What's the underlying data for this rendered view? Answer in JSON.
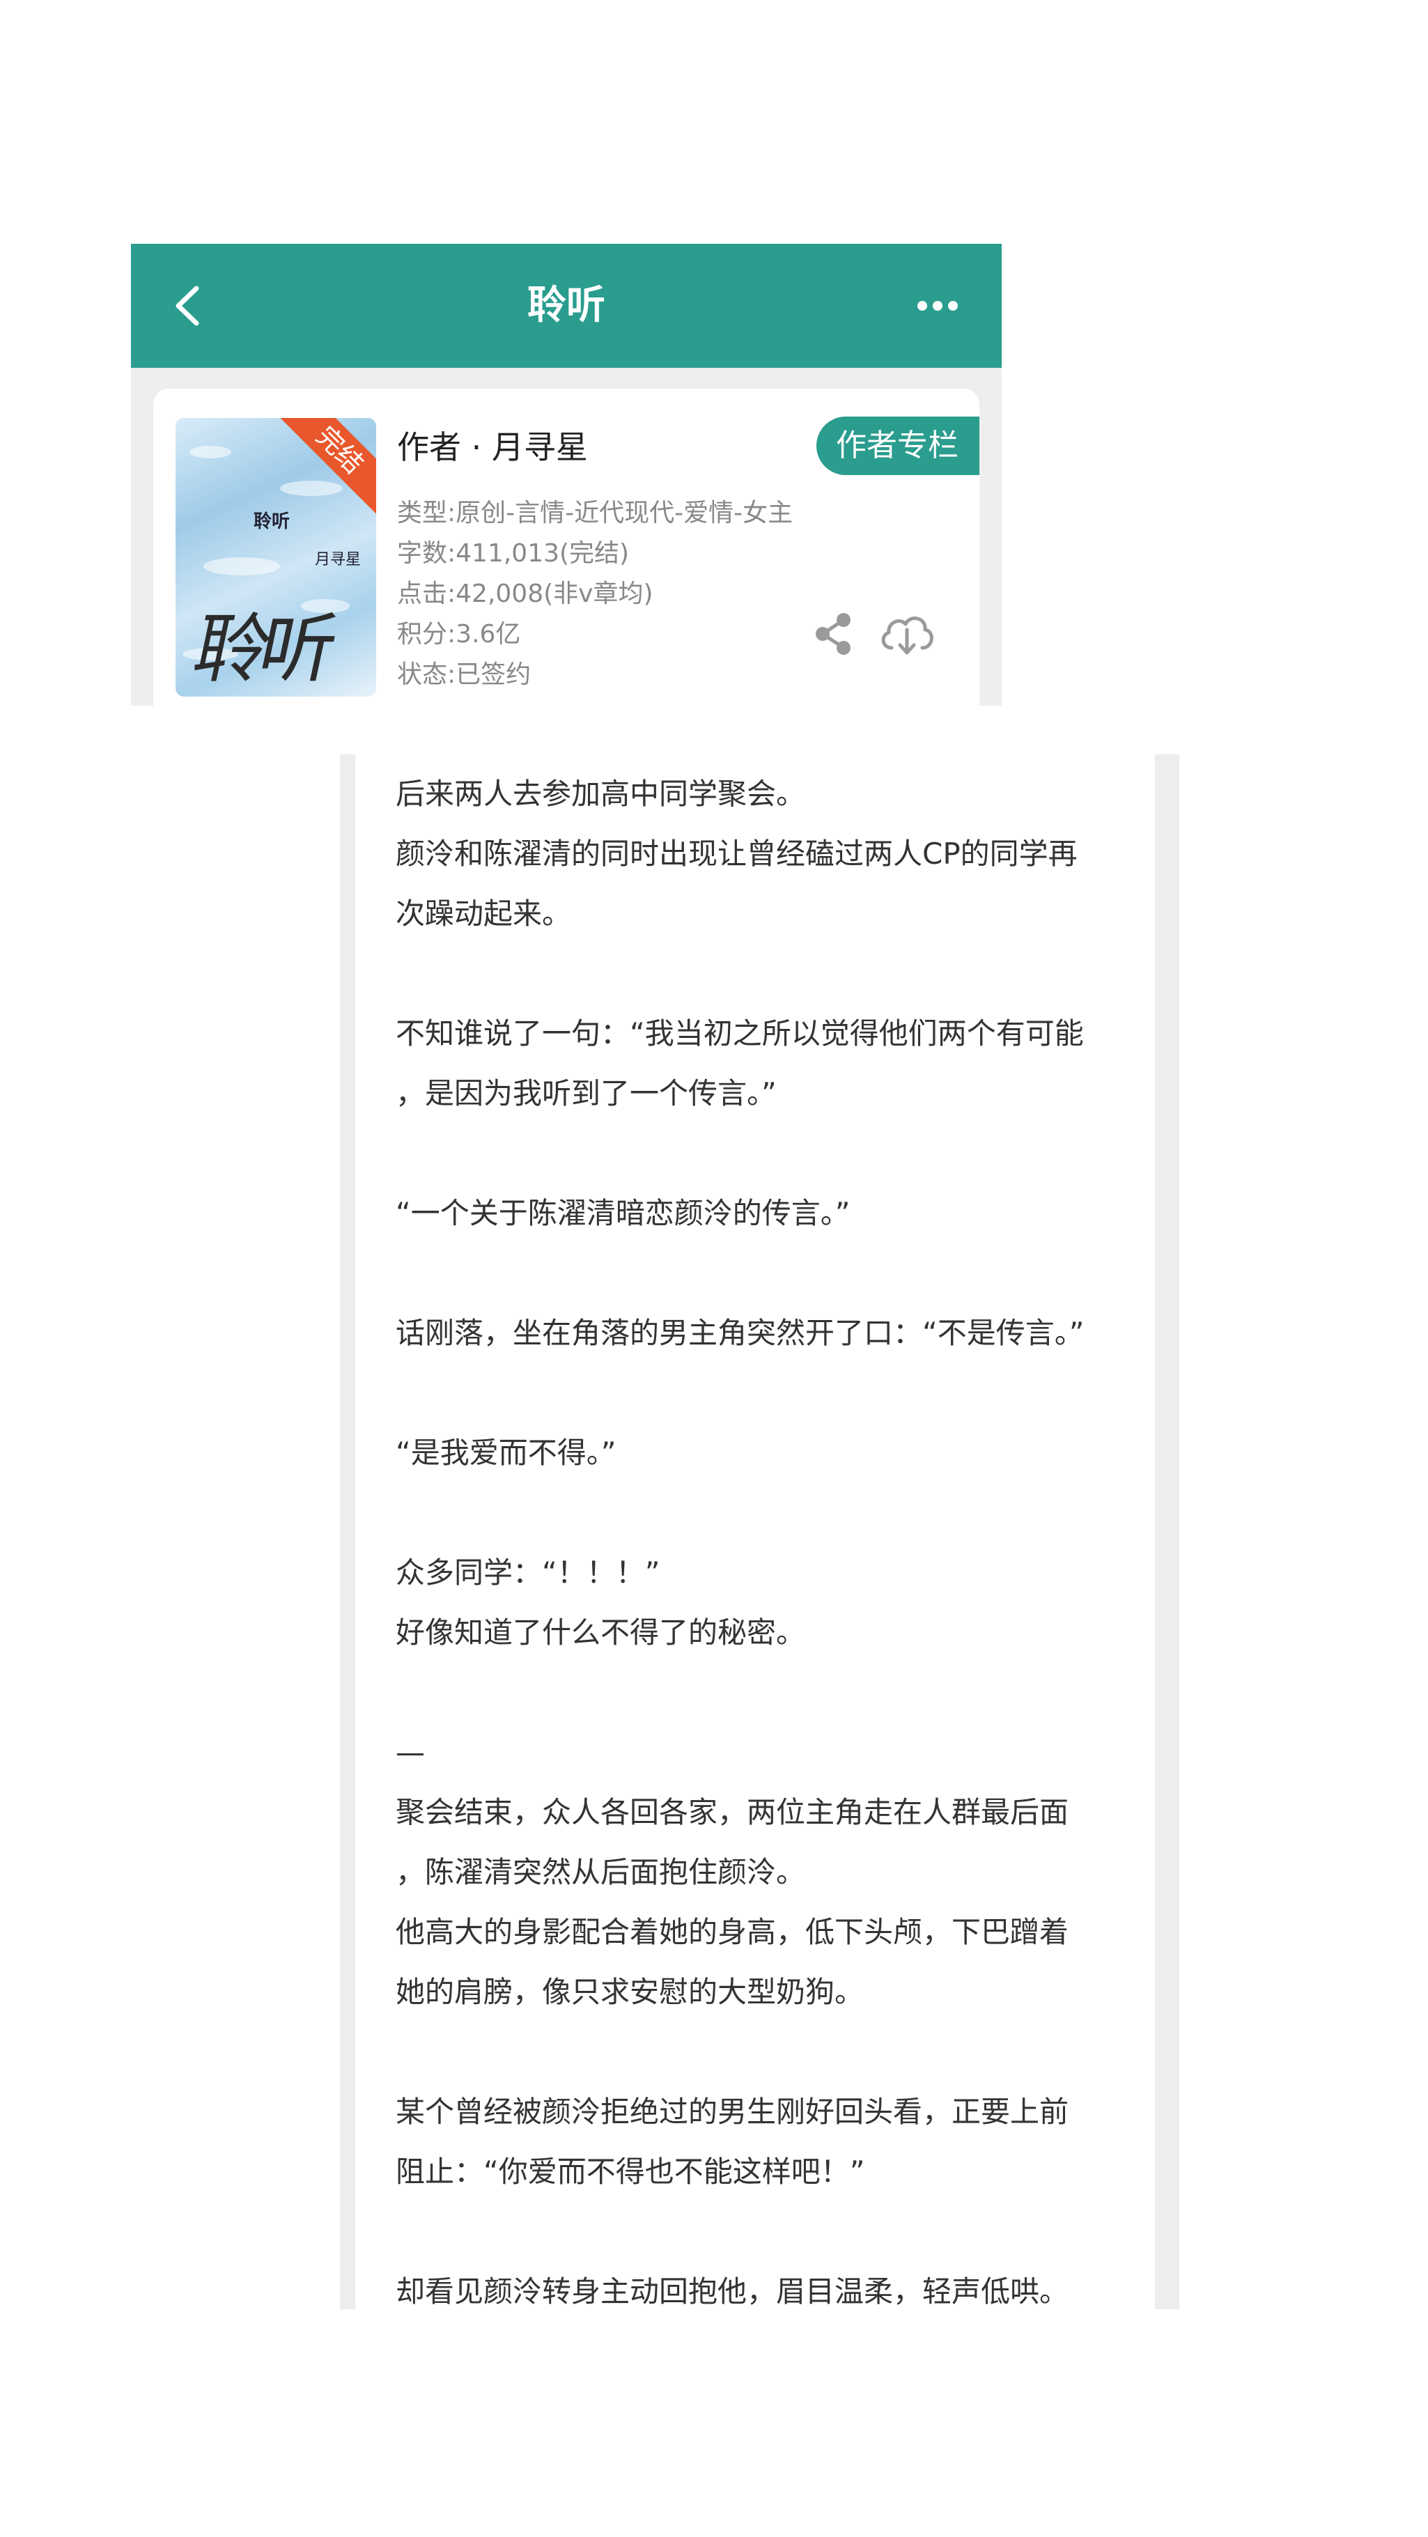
{
  "header": {
    "title": "聆听",
    "back_icon": "chevron-left-icon",
    "more_icon": "more-dots-icon",
    "color": "#2a9d8e"
  },
  "book": {
    "cover": {
      "title": "聆听",
      "author": "月寻星",
      "calligraphy": "聆听",
      "ribbon": "完结",
      "ribbon_color": "#e9572c"
    },
    "author_line": "作者 · 月寻星",
    "author_column_button": "作者专栏",
    "meta": {
      "type": "类型:原创-言情-近代现代-爱情-女主",
      "words": "字数:411,013(完结)",
      "clicks": "点击:42,008(非v章均)",
      "score": "积分:3.6亿",
      "status": "状态:已签约"
    },
    "share_icon": "share-icon",
    "download_icon": "cloud-download-icon"
  },
  "content": {
    "lines": [
      "后来两人去参加高中同学聚会。",
      "颜泠和陈濯清的同时出现让曾经磕过两人CP的同学再",
      "次躁动起来。",
      "",
      "不知谁说了一句：“我当初之所以觉得他们两个有可能",
      "，是因为我听到了一个传言。”",
      "",
      "“一个关于陈濯清暗恋颜泠的传言。”",
      "",
      "话刚落，坐在角落的男主角突然开了口：“不是传言。”",
      "",
      "“是我爱而不得。”",
      "",
      "众多同学：“！！！”",
      "好像知道了什么不得了的秘密。",
      "",
      "—",
      "聚会结束，众人各回各家，两位主角走在人群最后面",
      "，陈濯清突然从后面抱住颜泠。",
      "他高大的身影配合着她的身高，低下头颅，下巴蹭着",
      "她的肩膀，像只求安慰的大型奶狗。",
      "",
      "某个曾经被颜泠拒绝过的男生刚好回头看，正要上前",
      "阻止：“你爱而不得也不能这样吧！”",
      "",
      "却看见颜泠转身主动回抱他，眉目温柔，轻声低哄。"
    ]
  }
}
